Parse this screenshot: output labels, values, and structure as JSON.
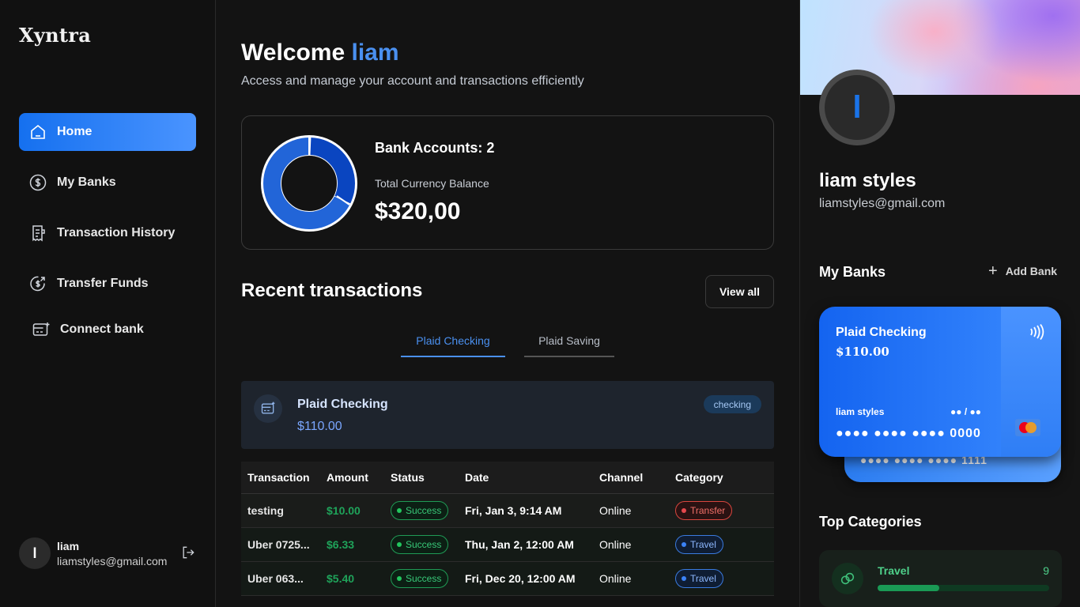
{
  "sidebar": {
    "logo": "Xyntra",
    "items": [
      {
        "label": "Home",
        "icon": "home-icon",
        "active": true
      },
      {
        "label": "My Banks",
        "icon": "dollar-circle-icon"
      },
      {
        "label": "Transaction History",
        "icon": "receipt-icon"
      },
      {
        "label": "Transfer Funds",
        "icon": "money-send-icon"
      },
      {
        "label": "Connect bank",
        "icon": "card-add-icon"
      }
    ],
    "user": {
      "initial": "l",
      "name": "liam",
      "email": "liamstyles@gmail.com"
    }
  },
  "main": {
    "welcome_prefix": "Welcome",
    "welcome_name": "liam",
    "subtitle": "Access and manage your account and transactions efficiently",
    "balance": {
      "bank_accounts_label": "Bank Accounts: 2",
      "total_label": "Total Currency Balance",
      "total_value": "$320,00"
    },
    "recent_title": "Recent transactions",
    "view_all": "View all",
    "tabs": [
      {
        "label": "Plaid Checking",
        "active": true
      },
      {
        "label": "Plaid Saving",
        "active": false
      }
    ],
    "account_card": {
      "name": "Plaid Checking",
      "balance": "$110.00",
      "badge": "checking"
    },
    "table": {
      "headers": [
        "Transaction",
        "Amount",
        "Status",
        "Date",
        "Channel",
        "Category"
      ],
      "rows": [
        {
          "name": "testing",
          "amount": "$10.00",
          "status": "Success",
          "date": "Fri, Jan 3, 9:14 AM",
          "channel": "Online",
          "category": "Transfer"
        },
        {
          "name": "Uber 0725...",
          "amount": "$6.33",
          "status": "Success",
          "date": "Thu, Jan 2, 12:00 AM",
          "channel": "Online",
          "category": "Travel"
        },
        {
          "name": "Uber 063...",
          "amount": "$5.40",
          "status": "Success",
          "date": "Fri, Dec 20, 12:00 AM",
          "channel": "Online",
          "category": "Travel"
        }
      ]
    }
  },
  "right": {
    "avatar_initial": "l",
    "name": "liam styles",
    "email": "liamstyles@gmail.com",
    "my_banks_title": "My Banks",
    "add_bank": "Add Bank",
    "card_front": {
      "name": "Plaid Checking",
      "balance": "$110.00",
      "holder": "liam styles",
      "expiry": "●● / ●●",
      "number": "●●●● ●●●● ●●●● 0000"
    },
    "card_back": {
      "number": "●●●● ●●●● ●●●● 1111"
    },
    "top_categories_title": "Top Categories",
    "categories": [
      {
        "name": "Travel",
        "count": "9",
        "progress": 0.36
      }
    ]
  },
  "colors": {
    "accent": "#4a90f0",
    "success": "#22c55e",
    "transfer": "#e5484d",
    "travel": "#3b82f6"
  }
}
